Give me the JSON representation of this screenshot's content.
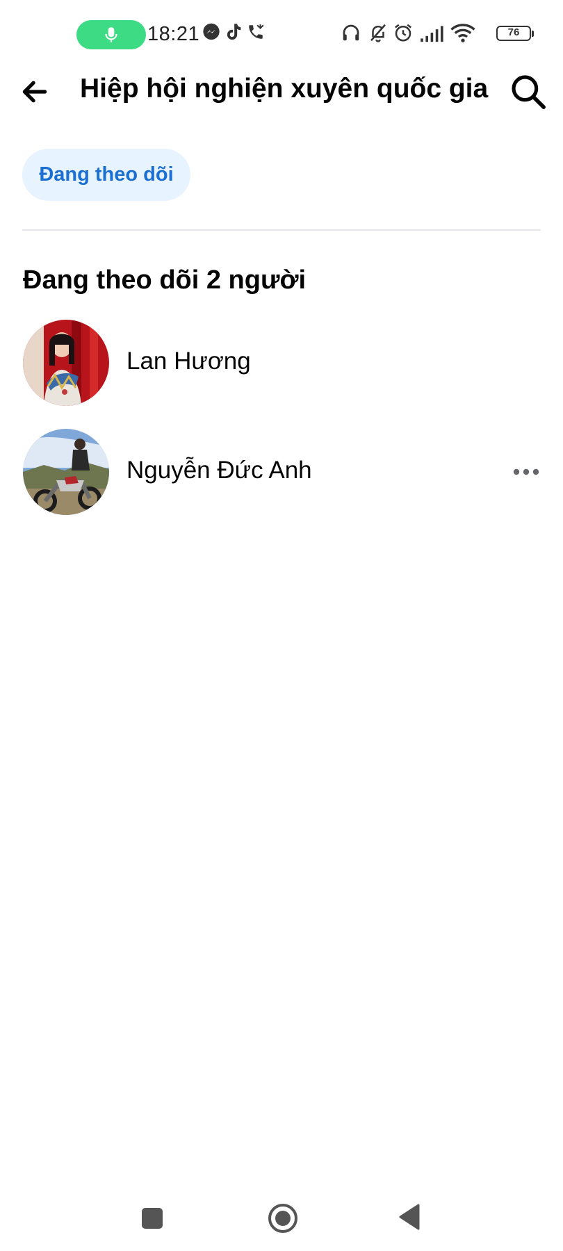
{
  "status_bar": {
    "time": "18:21",
    "battery_level": "76",
    "icons": [
      "microphone-icon",
      "messenger-icon",
      "tiktok-icon",
      "missed-call-icon",
      "headphones-icon",
      "bell-off-icon",
      "alarm-icon",
      "signal-icon",
      "wifi-icon",
      "battery-icon"
    ],
    "colors": {
      "mic_pill": "#3ddc84"
    }
  },
  "header": {
    "title": "Hiệp hội nghiện xuyên quốc gia",
    "back_icon": "arrow-left-icon",
    "search_icon": "search-icon"
  },
  "filter": {
    "chip_label": "Đang theo dõi",
    "colors": {
      "background": "#e7f3ff",
      "text": "#1b6fd1"
    }
  },
  "section": {
    "heading": "Đang theo dõi 2 người"
  },
  "members": [
    {
      "name": "Lan Hương",
      "has_more": false
    },
    {
      "name": "Nguyễn Đức Anh",
      "has_more": true,
      "more_icon": "more-horizontal-icon"
    }
  ],
  "nav_bar": {
    "buttons": [
      "recents-square-icon",
      "home-circle-icon",
      "back-triangle-icon"
    ]
  }
}
